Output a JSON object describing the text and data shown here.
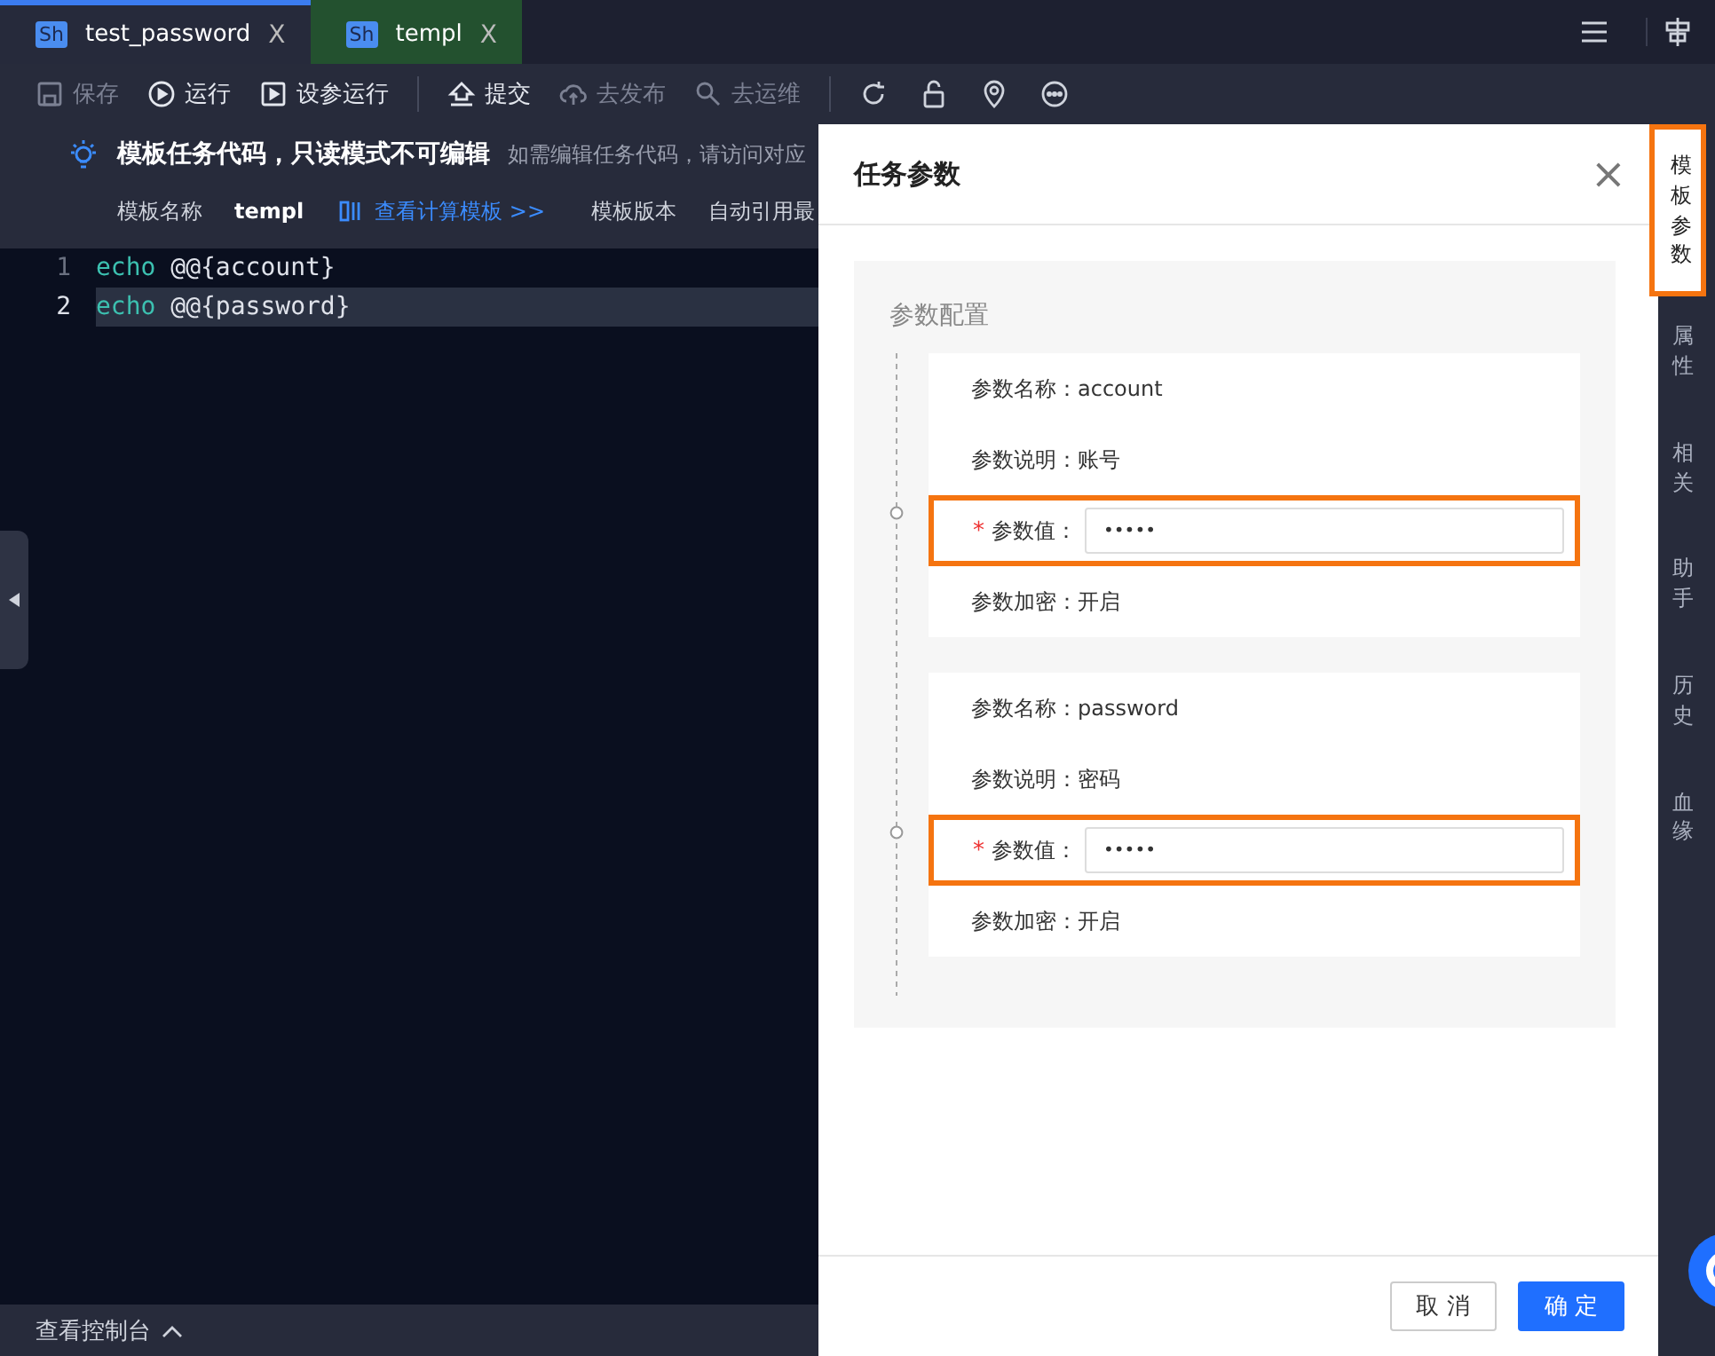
{
  "tabs": [
    {
      "badge": "Sh",
      "label": "test_password",
      "close": "X",
      "selected": true,
      "color": "#262a3b"
    },
    {
      "badge": "Sh",
      "label": "templ",
      "close": "X",
      "selected": false,
      "color": "#23512f"
    }
  ],
  "toolbar": [
    {
      "label": "保存",
      "disabled": true
    },
    {
      "label": "运行",
      "disabled": false
    },
    {
      "label": "设参运行",
      "disabled": false
    },
    {
      "label": "提交",
      "disabled": false
    },
    {
      "label": "去发布",
      "disabled": true
    },
    {
      "label": "去运维",
      "disabled": true
    }
  ],
  "banner": {
    "title": "模板任务代码，只读模式不可编辑",
    "note": "如需编辑任务代码，请访问对应"
  },
  "info": {
    "name_label": "模板名称",
    "name": "templ",
    "link": "查看计算模板 >>",
    "version_label": "模板版本",
    "version": "自动引用最"
  },
  "editor": {
    "lines": [
      {
        "number": "1",
        "keyword": "echo",
        "text": " @@{account}",
        "current": false
      },
      {
        "number": "2",
        "keyword": "echo",
        "text": " @@{password}",
        "current": true
      }
    ]
  },
  "console": {
    "label": "查看控制台"
  },
  "drawer": {
    "title": "任务参数",
    "close": "×",
    "section": "参数配置",
    "params": [
      {
        "name_label": "参数名称：",
        "name": "account",
        "desc_label": "参数说明：",
        "desc": "账号",
        "required": "*",
        "value_label": "参数值：",
        "value": "•••••",
        "highlighted": true,
        "encrypt_label": "参数加密：",
        "encrypt": "开启"
      },
      {
        "name_label": "参数名称：",
        "name": "password",
        "desc_label": "参数说明：",
        "desc": "密码",
        "required": "*",
        "value_label": "参数值：",
        "value": "•••••",
        "highlighted": true,
        "encrypt_label": "参数加密：",
        "encrypt": "开启"
      }
    ],
    "buttons": [
      {
        "label": "取 消",
        "kind": "secondary"
      },
      {
        "label": "确 定",
        "kind": "primary"
      }
    ]
  },
  "sidebar": [
    {
      "label": "模板参数",
      "selected": true
    },
    {
      "label": "属性",
      "selected": false
    },
    {
      "label": "相关",
      "selected": false
    },
    {
      "label": "助手",
      "selected": false
    },
    {
      "label": "历史",
      "selected": false
    },
    {
      "label": "血缘",
      "selected": false
    }
  ]
}
